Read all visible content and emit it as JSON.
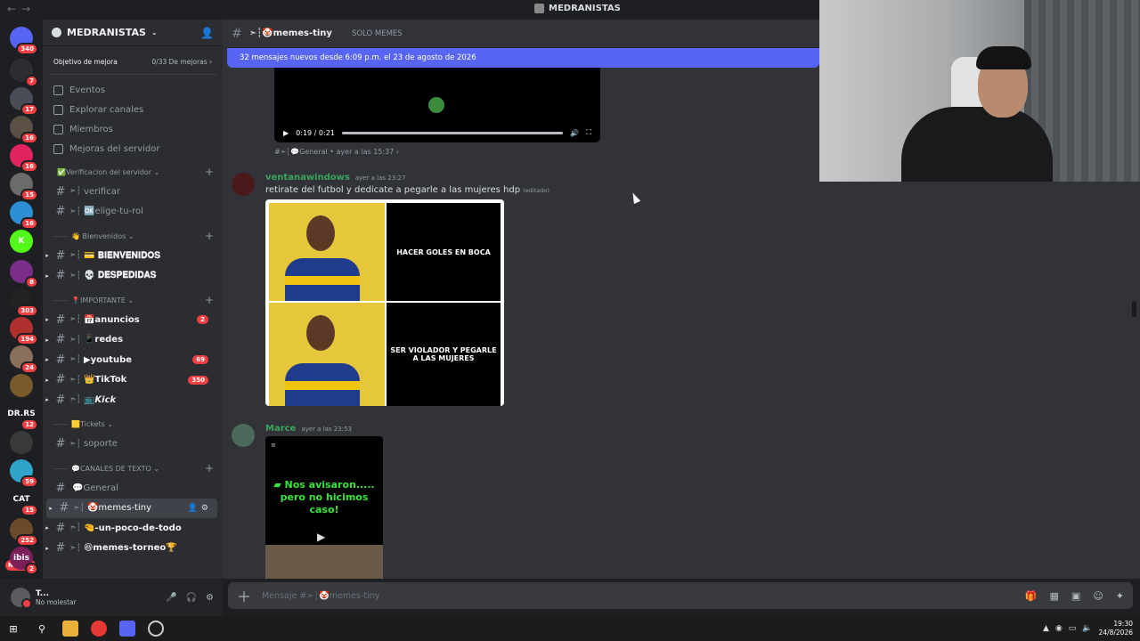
{
  "window": {
    "title": "MEDRANISTAS",
    "nav_back": "←",
    "nav_fwd": "→"
  },
  "rail": {
    "servers": [
      {
        "letters": "",
        "badge": "340",
        "color": "#5865f2",
        "icon": "discord-home-icon"
      },
      {
        "letters": "",
        "badge": "7",
        "color": "#2b2d31",
        "icon": "triangle-logo-icon"
      },
      {
        "letters": "",
        "badge": "17",
        "color": "#4a4d55",
        "icon": "server-icon"
      },
      {
        "letters": "",
        "badge": "16",
        "color": "#5a5044",
        "icon": "server-icon"
      },
      {
        "letters": "",
        "badge": "16",
        "color": "#e0245e",
        "icon": "server-icon"
      },
      {
        "letters": "",
        "badge": "15",
        "color": "#6b6b6b",
        "icon": "server-icon"
      },
      {
        "letters": "",
        "badge": "16",
        "color": "#2f8fd6",
        "icon": "server-icon"
      },
      {
        "letters": "K",
        "badge": "",
        "color": "#53fc18",
        "icon": "kick-icon"
      },
      {
        "letters": "",
        "badge": "8",
        "color": "#7b2d8a",
        "icon": "server-icon"
      },
      {
        "letters": "",
        "badge": "303",
        "color": "#222",
        "icon": "server-icon"
      },
      {
        "letters": "",
        "badge": "194",
        "color": "#b03030",
        "icon": "server-icon"
      },
      {
        "letters": "",
        "badge": "24",
        "color": "#8a6f5a",
        "icon": "server-icon"
      },
      {
        "letters": "",
        "badge": "",
        "color": "#7a5a2a",
        "icon": "server-icon"
      },
      {
        "letters": "DR.RS",
        "badge": "12",
        "color": "#1e1f22",
        "icon": "server-icon"
      },
      {
        "letters": "",
        "badge": "",
        "color": "#3a3a3a",
        "icon": "server-icon"
      },
      {
        "letters": "",
        "badge": "59",
        "color": "#2fa3c9",
        "icon": "server-icon"
      },
      {
        "letters": "CAT",
        "badge": "15",
        "color": "#1e1f22",
        "icon": "server-icon"
      },
      {
        "letters": "",
        "badge": "252",
        "color": "#6b4a2a",
        "icon": "server-icon"
      },
      {
        "letters": "ibis",
        "badge": "2",
        "color": "#7a1f5a",
        "icon": "server-icon"
      }
    ],
    "new_label": "NUEVO"
  },
  "sidebar": {
    "server_name": "MEDRANISTAS",
    "goal_label": "Objetivo de mejora",
    "goal_progress": "0/33 De mejoras",
    "nav": [
      {
        "label": "Eventos",
        "icon": "calendar-icon"
      },
      {
        "label": "Explorar canales",
        "icon": "browse-channels-icon"
      },
      {
        "label": "Miembros",
        "icon": "members-icon"
      },
      {
        "label": "Mejoras del servidor",
        "icon": "boost-icon"
      }
    ],
    "categories": [
      {
        "name": "✅Verificacion del servidor",
        "channels": [
          {
            "prefix": "➣┆",
            "label": "verificar",
            "unread": false,
            "count": ""
          },
          {
            "prefix": "➣┆",
            "label": "🆗elige-tu-rol",
            "unread": false,
            "count": ""
          }
        ]
      },
      {
        "name": "👋 Bienvenidos",
        "channels": [
          {
            "prefix": "➣┆",
            "label": "💳 𝐁𝐈𝐄𝐍𝐕𝐄𝐍𝐈𝐃𝐎𝐒",
            "unread": true,
            "count": ""
          },
          {
            "prefix": "➣┆",
            "label": "💀 𝐃𝐄𝐒𝐏𝐄𝐃𝐈𝐃𝐀𝐒",
            "unread": true,
            "count": ""
          }
        ]
      },
      {
        "name": "📍IMPORTANTE",
        "channels": [
          {
            "prefix": "➣┆",
            "label": "📅anuncios",
            "unread": true,
            "count": "2"
          },
          {
            "prefix": "➣┆",
            "label": "📱redes",
            "unread": true,
            "count": ""
          },
          {
            "prefix": "➣┆",
            "label": "▶youtube",
            "unread": true,
            "count": "69"
          },
          {
            "prefix": "➣┆",
            "label": "👑TikTok",
            "unread": true,
            "count": "350"
          },
          {
            "prefix": "➣┆",
            "label": "📺𝙆𝙞𝙘𝙠",
            "unread": true,
            "count": ""
          }
        ]
      },
      {
        "name": "🟨Tickets",
        "channels": [
          {
            "prefix": "➣┆",
            "label": "soporte",
            "unread": false,
            "count": ""
          }
        ]
      },
      {
        "name": "💬CANALES DE TEXTO",
        "channels": [
          {
            "prefix": "",
            "label": "💬General",
            "unread": false,
            "count": ""
          },
          {
            "prefix": "➣┆",
            "label": "🤡memes-tiny",
            "unread": false,
            "count": "",
            "active": true
          },
          {
            "prefix": "➣┆",
            "label": "🤏-un-poco-de-todo",
            "unread": true,
            "count": ""
          },
          {
            "prefix": "➣┆",
            "label": "😆memes-torneo🏆",
            "unread": true,
            "count": ""
          }
        ]
      }
    ]
  },
  "user": {
    "name": "T...",
    "status": "No molestar"
  },
  "chat": {
    "channel_prefix": "➣┆",
    "channel_name": "🤡memes-tiny",
    "topic": "SOLO MEMES",
    "new_messages": "32 mensajes nuevos desde 6:09 p.m. el 23 de agosto de 2026",
    "video_time": "0:19 / 0:21",
    "video_progress": 0.9,
    "forward_from": "#➣┆💬General • ayer a las 15:37 ›",
    "messages": [
      {
        "author": "ventanawindows",
        "time": "ayer a las 23:27",
        "text": "retirate del futbol y dedicate a pegarle a las mujeres hdp",
        "edited": "(editado)",
        "meme_top": "HACER GOLES EN BOCA",
        "meme_bottom": "SER VIOLADOR Y PEGARLE A LAS MUJERES"
      },
      {
        "author": "Marce",
        "time": "ayer a las 23:53",
        "video_caption": "▰ Nos avisaron.....\npero no hicimos caso!"
      }
    ],
    "composer_placeholder": "Mensaje #➣┆🤡memes-tiny"
  },
  "taskbar": {
    "time": "19:30",
    "date": "24/8/2026"
  }
}
